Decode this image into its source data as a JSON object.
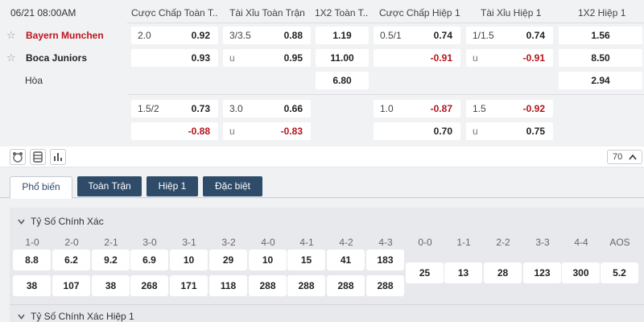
{
  "match": {
    "datetime": "06/21 08:00AM",
    "home": "Bayern Munchen",
    "away": "Boca Juniors",
    "draw": "Hòa"
  },
  "columns": [
    "Cược Chấp Toàn T...",
    "Tài Xỉu Toàn Trận",
    "1X2 Toàn T...",
    "Cược Chấp Hiệp 1",
    "Tài Xỉu Hiệp 1",
    "1X2 Hiệp 1"
  ],
  "row1": {
    "hc_full_home_line": "2.0",
    "hc_full_home_odds": "0.92",
    "hc_full_away_odds": "0.93",
    "ou_full_line": "3/3.5",
    "ou_full_over": "0.88",
    "ou_full_u": "u",
    "ou_full_under": "0.95",
    "x12_full_home": "1.19",
    "x12_full_away": "11.00",
    "x12_full_draw": "6.80",
    "hc_h1_home_line": "0.5/1",
    "hc_h1_home_odds": "0.74",
    "hc_h1_away_odds": "-0.91",
    "ou_h1_line": "1/1.5",
    "ou_h1_over": "0.74",
    "ou_h1_u": "u",
    "ou_h1_under": "-0.91",
    "x12_h1_home": "1.56",
    "x12_h1_away": "8.50",
    "x12_h1_draw": "2.94"
  },
  "row2": {
    "hc_full_home_line": "1.5/2",
    "hc_full_home_odds": "0.73",
    "hc_full_away_odds": "-0.88",
    "ou_full_line": "3.0",
    "ou_full_over": "0.66",
    "ou_full_u": "u",
    "ou_full_under": "-0.83",
    "hc_h1_home_line": "1.0",
    "hc_h1_home_odds": "-0.87",
    "hc_h1_away_odds": "0.70",
    "ou_h1_line": "1.5",
    "ou_h1_over": "-0.92",
    "ou_h1_u": "u",
    "ou_h1_under": "0.75"
  },
  "toolbar": {
    "count": "70"
  },
  "tabs": [
    "Phổ biến",
    "Toàn Trận",
    "Hiệp 1",
    "Đặc biệt"
  ],
  "correct_score": {
    "title": "Tỷ Số Chính Xác",
    "labels": [
      "1-0",
      "2-0",
      "2-1",
      "3-0",
      "3-1",
      "3-2",
      "4-0",
      "4-1",
      "4-2",
      "4-3",
      "0-0",
      "1-1",
      "2-2",
      "3-3",
      "4-4",
      "AOS"
    ],
    "home_row": [
      "8.8",
      "6.2",
      "9.2",
      "6.9",
      "10",
      "29",
      "10",
      "15",
      "41",
      "183"
    ],
    "away_row": [
      "38",
      "107",
      "38",
      "268",
      "171",
      "118",
      "288",
      "288",
      "288",
      "288"
    ],
    "draw_row": [
      "25",
      "13",
      "28",
      "123",
      "300",
      "5.2"
    ]
  },
  "correct_score_h1": {
    "title": "Tỷ Số Chính Xác Hiệp 1"
  }
}
